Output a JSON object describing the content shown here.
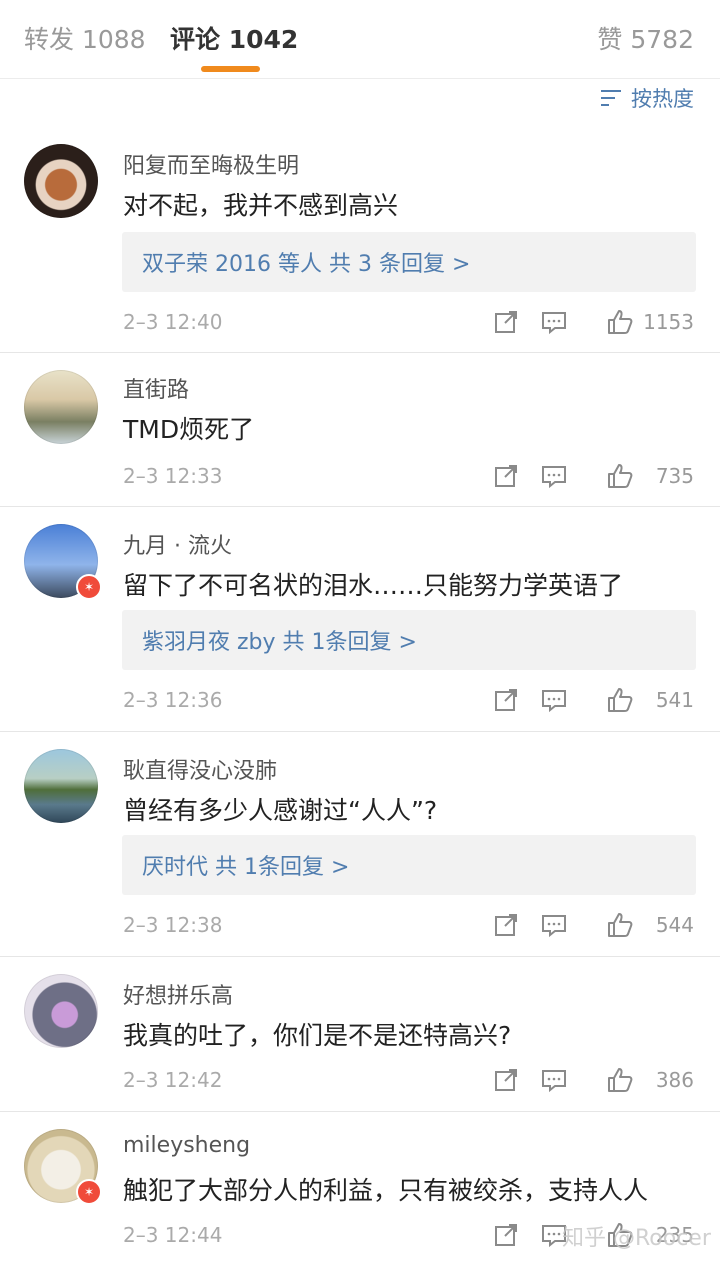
{
  "tabs": {
    "repost": "转发 1088",
    "comment": "评论 1042",
    "like": "赞 5782"
  },
  "sort": {
    "label": "按热度"
  },
  "comments": [
    {
      "name": "阳复而至晦极生明",
      "text": "对不起，我并不感到高兴",
      "replies": "双子荣 2016 等人  共 3 条回复 >",
      "time": "2–3 12:40",
      "likes": "1153"
    },
    {
      "name": "直街路",
      "text": "TMD烦死了",
      "time": "2–3 12:33",
      "likes": "735"
    },
    {
      "name": "九月 · 流火",
      "text": "留下了不可名状的泪水……只能努力学英语了",
      "replies": "紫羽月夜 zby  共 1条回复 >",
      "time": "2–3 12:36",
      "likes": "541"
    },
    {
      "name": "耿直得没心没肺",
      "text": "曾经有多少人感谢过“人人”?",
      "replies": "厌时代  共 1条回复 >",
      "time": "2–3 12:38",
      "likes": "544"
    },
    {
      "name": "好想拼乐高",
      "text": "我真的吐了，你们是不是还特高兴?",
      "time": "2–3 12:42",
      "likes": "386"
    },
    {
      "name": "mileysheng",
      "text": "触犯了大部分人的利益，只有被绞杀，支持人人",
      "time": "2–3 12:44",
      "likes": "235"
    }
  ],
  "watermark": "知乎 @Roocer"
}
